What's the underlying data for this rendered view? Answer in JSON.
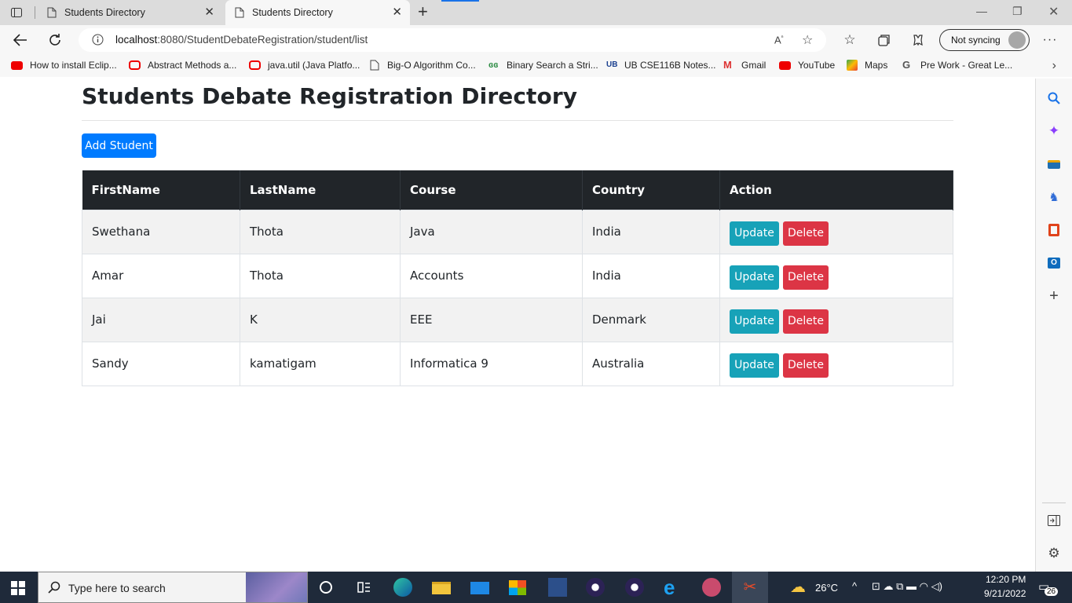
{
  "browser": {
    "tabs": [
      {
        "title": "Students Directory",
        "active": false
      },
      {
        "title": "Students Directory",
        "active": true
      }
    ],
    "url_host": "localhost",
    "url_rest": ":8080/StudentDebateRegistration/student/list",
    "sync_label": "Not syncing",
    "bookmarks": [
      {
        "label": "How to install Eclip...",
        "icon": "youtube-icon"
      },
      {
        "label": "Abstract Methods a...",
        "icon": "oracle-icon"
      },
      {
        "label": "java.util (Java Platfo...",
        "icon": "oracle-icon"
      },
      {
        "label": "Big-O Algorithm Co...",
        "icon": "page-icon"
      },
      {
        "label": "Binary Search a Stri...",
        "icon": "geeks-icon"
      },
      {
        "label": "UB CSE116B Notes...",
        "icon": "ub-icon"
      },
      {
        "label": "Gmail",
        "icon": "gmail-icon"
      },
      {
        "label": "YouTube",
        "icon": "youtube-icon"
      },
      {
        "label": "Maps",
        "icon": "maps-icon"
      },
      {
        "label": "Pre Work - Great Le...",
        "icon": "g-icon"
      }
    ]
  },
  "page": {
    "title": "Students Debate Registration Directory",
    "add_button": "Add Student",
    "columns": [
      "FirstName",
      "LastName",
      "Course",
      "Country",
      "Action"
    ],
    "update_label": "Update",
    "delete_label": "Delete",
    "rows": [
      {
        "first": "Swethana",
        "last": "Thota",
        "course": "Java",
        "country": "India"
      },
      {
        "first": "Amar",
        "last": "Thota",
        "course": "Accounts",
        "country": "India"
      },
      {
        "first": "Jai",
        "last": "K",
        "course": "EEE",
        "country": "Denmark"
      },
      {
        "first": "Sandy",
        "last": "kamatigam",
        "course": "Informatica 9",
        "country": "Australia"
      }
    ]
  },
  "taskbar": {
    "search_placeholder": "Type here to search",
    "temperature": "26°C",
    "time": "12:20 PM",
    "date": "9/21/2022",
    "notification_count": "26"
  },
  "colors": {
    "primary": "#007bff",
    "info": "#17a2b8",
    "danger": "#dc3545",
    "table_header": "#212529"
  }
}
